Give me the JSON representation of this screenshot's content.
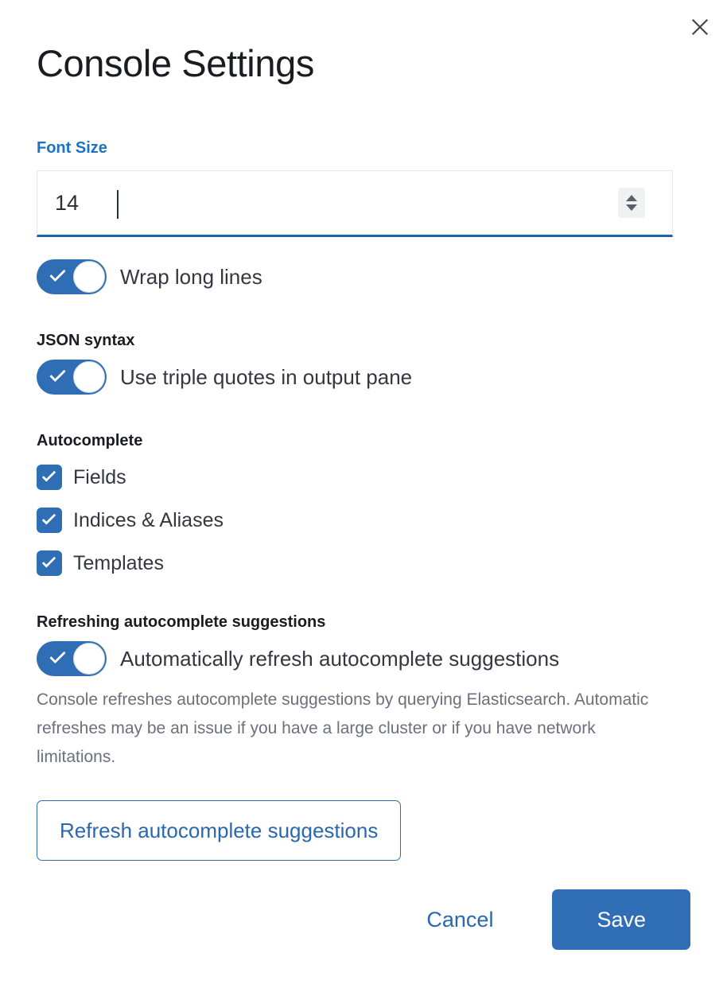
{
  "dialog": {
    "title": "Console Settings",
    "close_icon": "close-icon"
  },
  "font_size": {
    "label": "Font Size",
    "value": "14",
    "placeholder": "",
    "spinner_up_icon": "triangle-up-icon",
    "spinner_down_icon": "triangle-down-icon"
  },
  "wrap_lines": {
    "label": "Wrap long lines",
    "checked": true
  },
  "json_syntax": {
    "header": "JSON syntax",
    "triple_quotes_label": "Use triple quotes in output pane",
    "triple_quotes_checked": true
  },
  "autocomplete": {
    "header": "Autocomplete",
    "options": [
      {
        "label": "Fields",
        "checked": true
      },
      {
        "label": "Indices & Aliases",
        "checked": true
      },
      {
        "label": "Templates",
        "checked": true
      }
    ]
  },
  "refreshing": {
    "header": "Refreshing autocomplete suggestions",
    "auto_refresh_label": "Automatically refresh autocomplete suggestions",
    "auto_refresh_checked": true,
    "helper_text": "Console refreshes autocomplete suggestions by querying Elasticsearch. Automatic refreshes may be an issue if you have a large cluster or if you have network limitations.",
    "refresh_button_label": "Refresh autocomplete suggestions"
  },
  "footer": {
    "cancel_label": "Cancel",
    "save_label": "Save"
  },
  "colors": {
    "accent": "#2f6eb5",
    "link": "#2a67b1",
    "label_focus": "#1a73c4",
    "text": "#343741",
    "muted": "#6a717d",
    "title": "#1a1c21"
  }
}
